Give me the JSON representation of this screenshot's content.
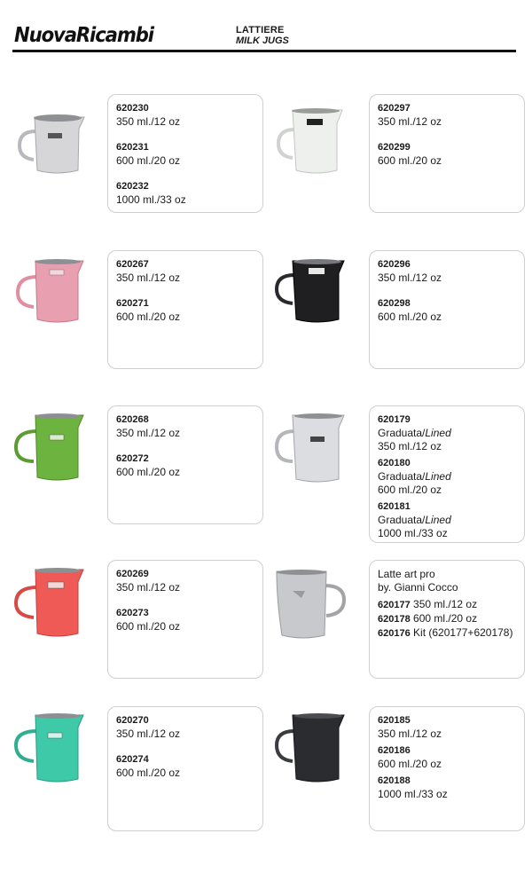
{
  "header": {
    "brand": "NuovaRicambi",
    "category_it": "LATTIERE",
    "category_en": "MILK JUGS"
  },
  "colors": {
    "silver": "#d6d6d8",
    "white": "#eef0ee",
    "pink": "#e89fb0",
    "black": "#1f1f22",
    "green": "#6db33f",
    "red": "#ef5a57",
    "teal": "#3ec9a8",
    "matte_black": "#2a2c30"
  },
  "products": {
    "p1": {
      "items": [
        {
          "code": "620230",
          "desc": "350 ml./12 oz"
        },
        {
          "code": "620231",
          "desc": "600 ml./20 oz"
        },
        {
          "code": "620232",
          "desc": "1000 ml./33 oz"
        }
      ]
    },
    "p2": {
      "items": [
        {
          "code": "620297",
          "desc": "350 ml./12 oz"
        },
        {
          "code": "620299",
          "desc": "600 ml./20 oz"
        }
      ]
    },
    "p3": {
      "items": [
        {
          "code": "620267",
          "desc": "350 ml./12 oz"
        },
        {
          "code": "620271",
          "desc": "600 ml./20 oz"
        }
      ]
    },
    "p4": {
      "items": [
        {
          "code": "620296",
          "desc": "350 ml./12 oz"
        },
        {
          "code": "620298",
          "desc": "600 ml./20 oz"
        }
      ]
    },
    "p5": {
      "items": [
        {
          "code": "620268",
          "desc": "350 ml./12 oz"
        },
        {
          "code": "620272",
          "desc": "600 ml./20 oz"
        }
      ]
    },
    "p6": {
      "items": [
        {
          "code": "620179",
          "type_it": "Graduata/",
          "type_en": "Lined",
          "desc": "350 ml./12 oz"
        },
        {
          "code": "620180",
          "type_it": "Graduata/",
          "type_en": "Lined",
          "desc": "600 ml./20 oz"
        },
        {
          "code": "620181",
          "type_it": "Graduata/",
          "type_en": "Lined",
          "desc": "1000 ml./33 oz"
        }
      ]
    },
    "p7": {
      "items": [
        {
          "code": "620269",
          "desc": "350 ml./12 oz"
        },
        {
          "code": "620273",
          "desc": "600 ml./20 oz"
        }
      ]
    },
    "p8": {
      "title": "Latte art pro",
      "subtitle": "by. Gianni Cocco",
      "items": [
        {
          "code": "620177",
          "desc": " 350 ml./12 oz"
        },
        {
          "code": "620178",
          "desc": " 600 ml./20 oz"
        },
        {
          "code": "620176",
          "desc": " Kit (620177+620178)"
        }
      ]
    },
    "p9": {
      "items": [
        {
          "code": "620270",
          "desc": "350 ml./12 oz"
        },
        {
          "code": "620274",
          "desc": "600 ml./20 oz"
        }
      ]
    },
    "p10": {
      "items": [
        {
          "code": "620185",
          "desc": "350 ml./12 oz"
        },
        {
          "code": "620186",
          "desc": "600 ml./20 oz"
        },
        {
          "code": "620188",
          "desc": "1000 ml./33 oz"
        }
      ]
    }
  }
}
